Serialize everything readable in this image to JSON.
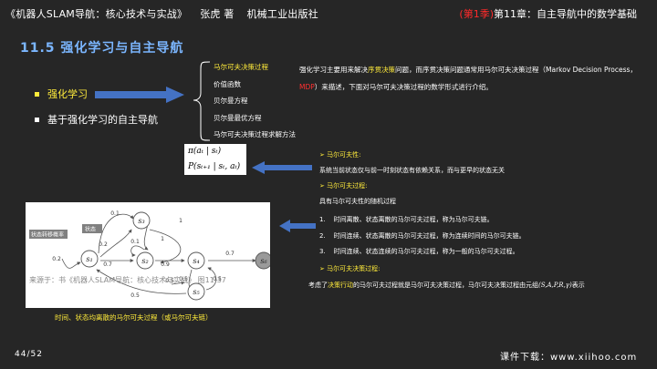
{
  "header": {
    "book_title": "《机器人SLAM导航：核心技术与实战》",
    "author": "张虎 著",
    "publisher": "机械工业出版社",
    "season": "(第1季)",
    "chapter": "第11章：自主导航中的数学基础"
  },
  "section_title": "11.5 强化学习与自主导航",
  "bullets": [
    "强化学习",
    "基于强化学习的自主导航"
  ],
  "sub_items": [
    "马尔可夫决策过程",
    "价值函数",
    "贝尔曼方程",
    "贝尔曼最优方程",
    "马尔可夫决策过程求解方法"
  ],
  "description": {
    "part1": "强化学习主要用来解决",
    "highlight": "序贯决策",
    "part2": "问题，而序贯决策问题通常用马尔可夫决策过程（Markov Decision Process，",
    "mdp": "MDP",
    "part3": "）来描述，下面对马尔可夫决策过程的数学形式进行介绍。"
  },
  "formulas": [
    "π(aₜ | sₜ)",
    "P(sₜ₊₁ | sₜ, aₜ)"
  ],
  "right_panel": {
    "markov_property_title": "马尔可夫性:",
    "markov_property_text": "系统当前状态仅与前一时刻状态有依赖关系，而与更早的状态无关",
    "markov_process_title": "马尔可夫过程:",
    "markov_process_intro": "具有马尔可夫性的随机过程",
    "list": [
      {
        "num": "1.",
        "text": "时间离散、状态离散的马尔可夫过程，称为马尔可夫链。"
      },
      {
        "num": "2.",
        "text": "时间连续、状态离散的马尔可夫过程，称为连续时间的马尔可夫链。"
      },
      {
        "num": "3.",
        "text": "时间连续、状态连续的马尔可夫过程，称为一般的马尔可夫过程。"
      }
    ],
    "mdp_title": "马尔可夫决策过程:",
    "mdp_text_pre": "考虑了",
    "mdp_highlight": "决策行动",
    "mdp_text_post": "的马尔可夫过程就是马尔可夫决策过程，马尔可夫决策过程由元组",
    "mdp_tuple": "(S,A,P,R,γ)",
    "mdp_text_end": "表示"
  },
  "diagram": {
    "states": [
      "s₁",
      "s₂",
      "s₃",
      "s₄",
      "s₅",
      "s₆"
    ],
    "edge_labels": [
      "0.1",
      "0.1",
      "1",
      "0.2",
      "0.7",
      "0.9",
      "0.7",
      "0.5",
      "0.5",
      "0.5",
      "0.5",
      "0.2",
      "1"
    ],
    "label_transition": "状态转移概率",
    "label_state": "状态"
  },
  "watermark": "来源于：书《机器人SLAM导航：核心技术与实战》 图11-37",
  "caption": "时间、状态均离散的马尔可夫过程（或马尔可夫链）",
  "page_number": "44/52",
  "download": "课件下载：www.xiihoo.com",
  "colors": {
    "accent_blue": "#4472c4",
    "title_blue": "#7bb6ff",
    "highlight_yellow": "#ffeb3b",
    "highlight_red": "#ff3030",
    "background": "#262626"
  }
}
